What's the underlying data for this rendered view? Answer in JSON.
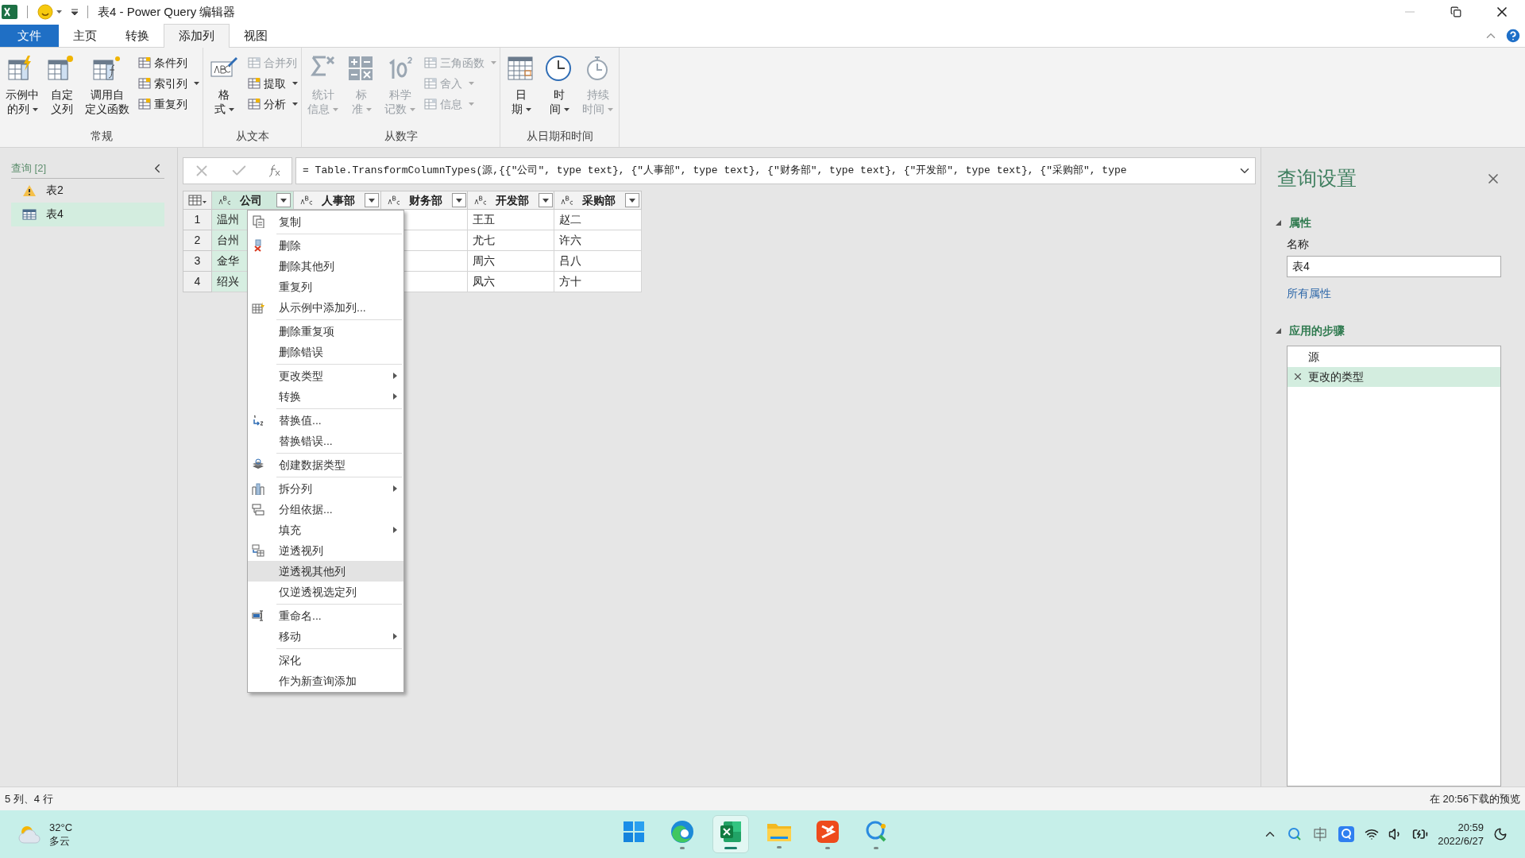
{
  "title_bar": {
    "title": "表4 - Power Query 编辑器"
  },
  "ribbon_tabs": [
    {
      "label": "文件",
      "kind": "backstage",
      "selected": false
    },
    {
      "label": "主页",
      "kind": "tab",
      "selected": false
    },
    {
      "label": "转换",
      "kind": "tab",
      "selected": false
    },
    {
      "label": "添加列",
      "kind": "tab",
      "selected": true
    },
    {
      "label": "视图",
      "kind": "tab",
      "selected": false
    }
  ],
  "ribbon_groups": [
    {
      "label": "常规",
      "large": [
        {
          "label": "示例中的列",
          "dropdown": true,
          "disabled": false
        },
        {
          "label": "自定义列",
          "dropdown": false,
          "disabled": false
        },
        {
          "label": "调用自定义函数",
          "dropdown": false,
          "disabled": false
        }
      ],
      "small": [
        {
          "label": "条件列",
          "dropdown": false,
          "disabled": false
        },
        {
          "label": "索引列",
          "dropdown": true,
          "disabled": false
        },
        {
          "label": "重复列",
          "dropdown": false,
          "disabled": false
        }
      ]
    },
    {
      "label": "从文本",
      "large": [
        {
          "label": "格式",
          "dropdown": true,
          "disabled": false
        }
      ],
      "small": [
        {
          "label": "合并列",
          "dropdown": false,
          "disabled": true
        },
        {
          "label": "提取",
          "dropdown": true,
          "disabled": false
        },
        {
          "label": "分析",
          "dropdown": true,
          "disabled": false
        }
      ]
    },
    {
      "label": "从数字",
      "large": [
        {
          "label": "统计信息",
          "dropdown": true,
          "disabled": true
        },
        {
          "label": "标准",
          "dropdown": true,
          "disabled": true
        },
        {
          "label": "科学记数",
          "dropdown": true,
          "disabled": true
        }
      ],
      "small": [
        {
          "label": "三角函数",
          "dropdown": true,
          "disabled": true
        },
        {
          "label": "舍入",
          "dropdown": true,
          "disabled": true
        },
        {
          "label": "信息",
          "dropdown": true,
          "disabled": true
        }
      ]
    },
    {
      "label": "从日期和时间",
      "large": [
        {
          "label": "日期",
          "dropdown": true,
          "disabled": false
        },
        {
          "label": "时间",
          "dropdown": true,
          "disabled": false
        },
        {
          "label": "持续时间",
          "dropdown": true,
          "disabled": true
        }
      ]
    }
  ],
  "queries": {
    "header": "查询 [2]",
    "items": [
      {
        "label": "表2",
        "kind": "warning",
        "selected": false
      },
      {
        "label": "表4",
        "kind": "table",
        "selected": true
      }
    ]
  },
  "formula_bar": {
    "formula": "= Table.TransformColumnTypes(源,{{\"公司\", type text}, {\"人事部\", type text}, {\"财务部\", type text}, {\"开发部\", type text}, {\"采购部\", type"
  },
  "table": {
    "columns": [
      {
        "header": "公司",
        "selected": true
      },
      {
        "header": "人事部",
        "selected": false
      },
      {
        "header": "财务部",
        "selected": false
      },
      {
        "header": "开发部",
        "selected": false
      },
      {
        "header": "采购部",
        "selected": false
      }
    ],
    "rows": [
      {
        "number": "1",
        "company": "温州",
        "development": "王五",
        "purchasing": "赵二"
      },
      {
        "number": "2",
        "company": "台州",
        "development": "尤七",
        "purchasing": "许六"
      },
      {
        "number": "3",
        "company": "金华",
        "development": "周六",
        "purchasing": "吕八"
      },
      {
        "number": "4",
        "company": "绍兴",
        "development": "凤六",
        "purchasing": "方十"
      }
    ]
  },
  "context_menu": {
    "groups": [
      [
        {
          "label": "复制",
          "submenu": false,
          "highlighted": false
        }
      ],
      [
        {
          "label": "删除",
          "submenu": false,
          "highlighted": false
        },
        {
          "label": "删除其他列",
          "submenu": false,
          "highlighted": false
        },
        {
          "label": "重复列",
          "submenu": false,
          "highlighted": false
        },
        {
          "label": "从示例中添加列...",
          "submenu": false,
          "highlighted": false
        }
      ],
      [
        {
          "label": "删除重复项",
          "submenu": false,
          "highlighted": false
        },
        {
          "label": "删除错误",
          "submenu": false,
          "highlighted": false
        }
      ],
      [
        {
          "label": "更改类型",
          "submenu": true,
          "highlighted": false
        },
        {
          "label": "转换",
          "submenu": true,
          "highlighted": false
        }
      ],
      [
        {
          "label": "替换值...",
          "submenu": false,
          "highlighted": false
        },
        {
          "label": "替换错误...",
          "submenu": false,
          "highlighted": false
        }
      ],
      [
        {
          "label": "创建数据类型",
          "submenu": false,
          "highlighted": false
        }
      ],
      [
        {
          "label": "拆分列",
          "submenu": true,
          "highlighted": false
        },
        {
          "label": "分组依据...",
          "submenu": false,
          "highlighted": false
        },
        {
          "label": "填充",
          "submenu": true,
          "highlighted": false
        },
        {
          "label": "逆透视列",
          "submenu": false,
          "highlighted": false
        },
        {
          "label": "逆透视其他列",
          "submenu": false,
          "highlighted": true
        },
        {
          "label": "仅逆透视选定列",
          "submenu": false,
          "highlighted": false
        }
      ],
      [
        {
          "label": "重命名...",
          "submenu": false,
          "highlighted": false
        },
        {
          "label": "移动",
          "submenu": true,
          "highlighted": false
        }
      ],
      [
        {
          "label": "深化",
          "submenu": false,
          "highlighted": false
        },
        {
          "label": "作为新查询添加",
          "submenu": false,
          "highlighted": false
        }
      ]
    ]
  },
  "settings": {
    "title": "查询设置",
    "properties": {
      "heading": "属性",
      "expanded": true,
      "name_label": "名称",
      "name_value": "表4",
      "link": "所有属性"
    },
    "steps": {
      "heading": "应用的步骤",
      "expanded": true,
      "items": [
        {
          "label": "源",
          "selected": false
        },
        {
          "label": "更改的类型",
          "selected": true
        }
      ]
    }
  },
  "status_bar": {
    "left": "5 列、4 行",
    "right": "在 20:56下载的预览"
  },
  "taskbar": {
    "weather": {
      "temperature": "32°C",
      "condition": "多云"
    },
    "apps": [
      {
        "running": false,
        "selected": false
      },
      {
        "running": true,
        "selected": false
      },
      {
        "running": true,
        "selected": true
      },
      {
        "running": true,
        "selected": false
      },
      {
        "running": true,
        "selected": false
      },
      {
        "running": true,
        "selected": false
      }
    ],
    "clock": {
      "time": "20:59",
      "date": "2022/6/27"
    }
  }
}
